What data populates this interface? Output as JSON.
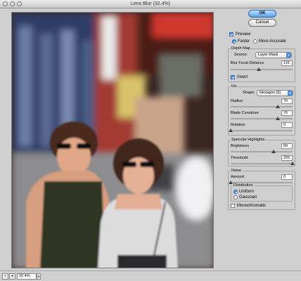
{
  "window": {
    "title": "Lens Blur (32.4%)"
  },
  "buttons": {
    "ok": "OK",
    "cancel": "Cancel"
  },
  "preview": {
    "label": "Preview",
    "checked": true,
    "faster": "Faster",
    "more_accurate": "More Accurate",
    "mode": "Faster"
  },
  "depth_map": {
    "title": "Depth Map",
    "source_label": "Source:",
    "source_value": "Layer Mask",
    "focal_label": "Blur Focal Distance",
    "focal_value": "116",
    "focal_fraction": 0.45,
    "invert_label": "Invert",
    "invert_checked": true
  },
  "iris": {
    "title": "Iris",
    "shape_label": "Shape:",
    "shape_value": "Hexagon (6)",
    "radius_label": "Radius",
    "radius_value": "76",
    "radius_fraction": 0.76,
    "curvature_label": "Blade Curvature",
    "curvature_value": "76",
    "curvature_fraction": 0.76,
    "rotation_label": "Rotation",
    "rotation_value": "0",
    "rotation_fraction": 0.0
  },
  "specular": {
    "title": "Specular Highlights",
    "brightness_label": "Brightness",
    "brightness_value": "69",
    "brightness_fraction": 0.69,
    "threshold_label": "Threshold",
    "threshold_value": "255",
    "threshold_fraction": 1.0
  },
  "noise": {
    "title": "Noise",
    "amount_label": "Amount",
    "amount_value": "0",
    "amount_fraction": 0.0,
    "distribution_title": "Distribution",
    "uniform": "Uniform",
    "gaussian": "Gaussian",
    "distribution": "Uniform",
    "mono_label": "Monochromatic",
    "mono_checked": false
  },
  "status": {
    "zoom": "32.4%",
    "minus": "−",
    "plus": "+"
  },
  "colors": {
    "accent": "#4a90e2",
    "panel_bg": "#cfcfcf"
  }
}
